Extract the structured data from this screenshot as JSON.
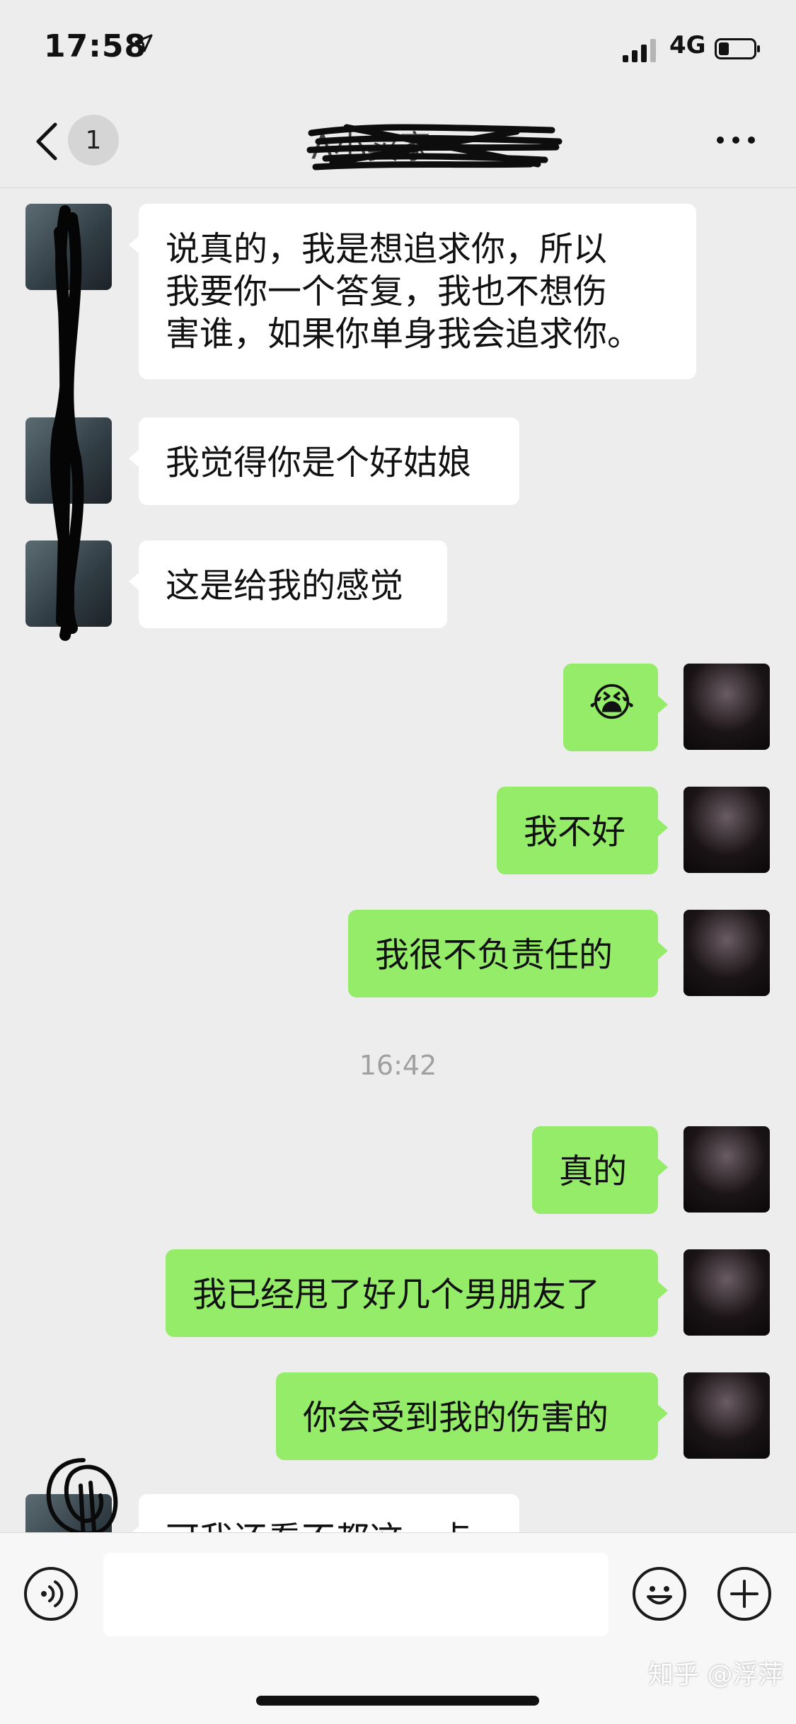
{
  "status_bar": {
    "time": "17:58",
    "network": "4G"
  },
  "header": {
    "badge_count": "1",
    "title": "A小卖家"
  },
  "messages": [
    {
      "side": "left",
      "text": "说真的，我是想追求你，所以\n我要你一个答复，我也不想伤\n害谁，如果你单身我会追求你。"
    },
    {
      "side": "left",
      "text": "我觉得你是个好姑娘"
    },
    {
      "side": "left",
      "text": "这是给我的感觉"
    },
    {
      "side": "right",
      "text": "😭"
    },
    {
      "side": "right",
      "text": "我不好"
    },
    {
      "side": "right",
      "text": "我很不负责任的"
    },
    {
      "side": "right",
      "text": "真的"
    },
    {
      "side": "right",
      "text": "我已经甩了好几个男朋友了"
    },
    {
      "side": "right",
      "text": "你会受到我的伤害的"
    },
    {
      "side": "left",
      "text": "可我还看不都这一点"
    }
  ],
  "timestamp": "16:42",
  "watermark": "知乎 @浮萍",
  "icons": [
    "location-arrow-icon",
    "signal-icon",
    "battery-icon",
    "back-chevron-icon",
    "more-icon",
    "voice-icon",
    "emoji-icon",
    "plus-icon"
  ]
}
